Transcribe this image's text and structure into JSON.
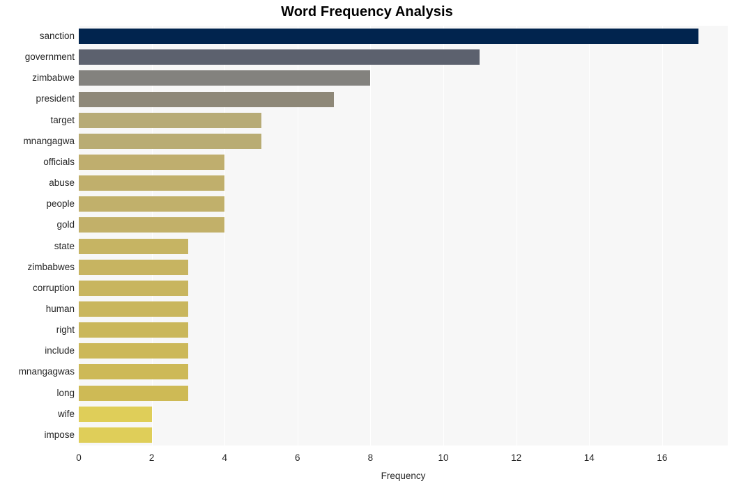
{
  "chart_data": {
    "type": "bar",
    "orientation": "horizontal",
    "title": "Word Frequency Analysis",
    "xlabel": "Frequency",
    "ylabel": "",
    "categories": [
      "sanction",
      "government",
      "zimbabwe",
      "president",
      "target",
      "mnangagwa",
      "officials",
      "abuse",
      "people",
      "gold",
      "state",
      "zimbabwes",
      "corruption",
      "human",
      "right",
      "include",
      "mnangagwas",
      "long",
      "wife",
      "impose"
    ],
    "values": [
      17,
      11,
      8,
      7,
      5,
      5,
      4,
      4,
      4,
      4,
      3,
      3,
      3,
      3,
      3,
      3,
      3,
      3,
      2,
      2
    ],
    "bar_colors": [
      "#01244e",
      "#5c616e",
      "#83827e",
      "#8e8878",
      "#b7ab76",
      "#b9ac73",
      "#bfae6e",
      "#c0af6c",
      "#c1b06b",
      "#c2b069",
      "#c6b463",
      "#c7b461",
      "#c8b55f",
      "#c9b65d",
      "#cab75b",
      "#ccb859",
      "#cdb957",
      "#ceba55",
      "#dfce59",
      "#dfce59"
    ],
    "xlim": [
      0,
      17.8
    ],
    "xticks": [
      0,
      2,
      4,
      6,
      8,
      10,
      12,
      14,
      16
    ],
    "xtick_labels": [
      "0",
      "2",
      "4",
      "6",
      "8",
      "10",
      "12",
      "14",
      "16"
    ],
    "grid": true,
    "grid_color": "#ffffff",
    "plot_background": "#f7f7f7",
    "figure_background": "#ffffff",
    "legend": null
  }
}
